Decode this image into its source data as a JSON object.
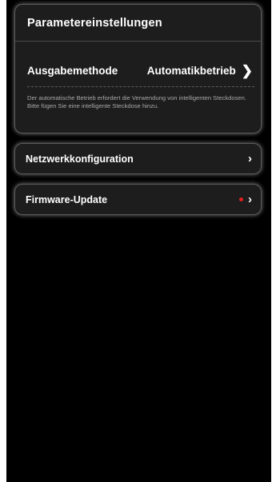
{
  "parameters": {
    "title": "Parametereinstellungen",
    "output_method": {
      "label": "Ausgabemethode",
      "value": "Automatikbetrieb"
    },
    "note": "Der automatische Betrieb erfordert die Verwendung von intelligenten Steckdosen. Bitte fügen Sie eine intelligente Steckdose hinzu."
  },
  "menu": {
    "network": {
      "label": "Netzwerkkonfiguration"
    },
    "firmware": {
      "label": "Firmware-Update",
      "has_update": true
    }
  },
  "colors": {
    "background": "#000000",
    "card": "#1d1d1d",
    "card_border": "#5a5a5a",
    "note_text": "#a9a9a9",
    "update_dot": "#e02020"
  },
  "icons": {
    "chevron": "chevron-right-icon",
    "update_indicator": "red-dot-icon"
  }
}
